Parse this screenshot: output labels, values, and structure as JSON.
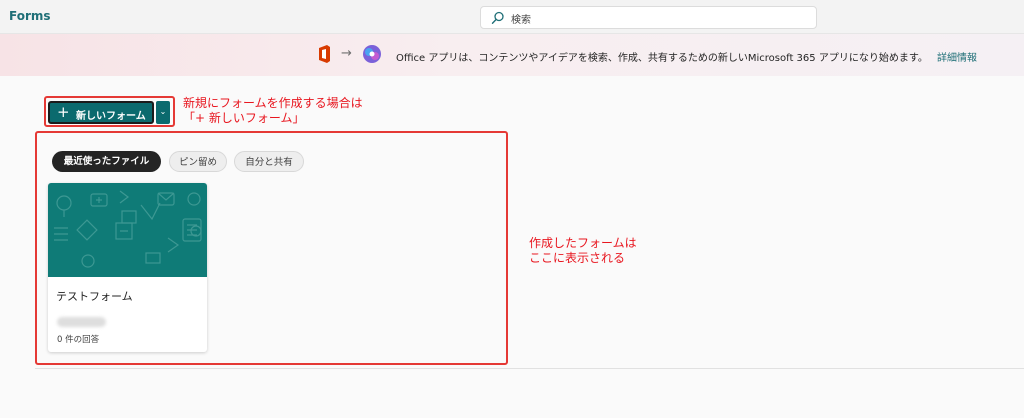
{
  "app": {
    "title": "Forms"
  },
  "search": {
    "placeholder": "検索"
  },
  "banner": {
    "message": "Office アプリは、コンテンツやアイデアを検索、作成、共有するための新しいMicrosoft 365 アプリになり始めます。",
    "link": "詳細情報"
  },
  "toolbar": {
    "new_plus": "+",
    "new_label": "新しいフォーム"
  },
  "filters": [
    {
      "label": "最近使ったファイル",
      "selected": true
    },
    {
      "label": "ピン留め",
      "selected": false
    },
    {
      "label": "自分と共有",
      "selected": false
    }
  ],
  "forms": [
    {
      "title": "テストフォーム",
      "responses": "0 件の回答"
    }
  ],
  "annotations": {
    "new_form_line1": "新規にフォームを作成する場合は",
    "new_form_line2": "「+ 新しいフォーム」",
    "list_line1": "作成したフォームは",
    "list_line2": "ここに表示される"
  },
  "colors": {
    "brand": "#0b6a6e",
    "annotation": "#e8161f",
    "card_thumb": "#0f7b77"
  }
}
